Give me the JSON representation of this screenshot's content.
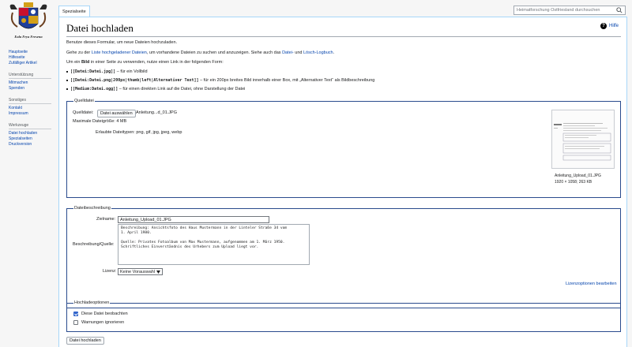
{
  "logo": {
    "motto": "Eala Frya Fresena"
  },
  "sidebar": {
    "nav": [
      {
        "label": "Hauptseite"
      },
      {
        "label": "Hilfeseite"
      },
      {
        "label": "Zufälliger Artikel"
      }
    ],
    "sections": [
      {
        "heading": "Unterstützung",
        "items": [
          {
            "label": "Mitmachen"
          },
          {
            "label": "Spenden"
          }
        ]
      },
      {
        "heading": "Sonstiges",
        "items": [
          {
            "label": "Kontakt"
          },
          {
            "label": "Impressum"
          }
        ]
      },
      {
        "heading": "Werkzeuge",
        "items": [
          {
            "label": "Datei hochladen"
          },
          {
            "label": "Spezialseiten"
          },
          {
            "label": "Druckversion"
          }
        ]
      }
    ]
  },
  "tabs": {
    "special": "Spezialseite"
  },
  "search": {
    "placeholder": "Heimatforschung Ostfriesland durchsuchen"
  },
  "page": {
    "title": "Datei hochladen",
    "help": "Hilfe",
    "intro1": "Benutze dieses Formular, um neue Dateien hochzuladen.",
    "intro2a": "Gehe zu der ",
    "intro2_link1": "Liste hochgeladener Dateien",
    "intro2b": ", um vorhandene Dateien zu suchen und anzuzeigen. Siehe auch das ",
    "intro2_link2": "Datei-",
    "intro2c": " und ",
    "intro2_link3": "Lösch-Logbuch",
    "intro2d": ".",
    "intro3a": "Um ein ",
    "intro3_bold": "Bild",
    "intro3b": " in einer Seite zu verwenden, nutze einen Link in der folgenden Form:",
    "bullets": [
      {
        "code": "[[Datei:Datei.jpg]]",
        "text": " – für ein Vollbild"
      },
      {
        "code": "[[Datei:Datei.png|200px|thumb|left|Alternativer Text]]",
        "text": " – für ein 200px breites Bild innerhalb einer Box, mit „Alternativer Text“ als Bildbeschreibung"
      },
      {
        "code": "[[Medium:Datei.ogg]]",
        "text": " – für einen direkten Link auf die Datei, ohne Darstellung der Datei"
      }
    ]
  },
  "source": {
    "legend": "Quelldatei",
    "file_label": "Quelldatei:",
    "choose_button": "Datei auswählen",
    "chosen_file": "Anleitung...d_01.JPG",
    "max_size": "Maximale Dateigröße: 4 MB",
    "allowed_types": "Erlaubte Dateitypen: png, gif, jpg, jpeg, webp",
    "thumb_name": "Anleitung_Upload_01.JPG",
    "thumb_meta": "1920 × 1058; 263 KB"
  },
  "description": {
    "legend": "Dateibeschreibung",
    "target_label": "Zielname:",
    "target_value": "Anleitung_Upload_01.JPG",
    "desc_label": "Beschreibung/Quelle:",
    "desc_value": "Beschreibung: Ansichtsfoto des Haus Mustermann in der Linteler Straße 34 vom\n1. April 1980.\n\nQuelle: Privates Fotoalbum von Max Mustermann, aufgenommen am 1. März 1950.\nSchriftliches Einverständnis des Urhebers zum Upload liegt vor.",
    "license_label": "Lizenz:",
    "license_value": "Keine Vorauswahl",
    "license_link": "Lizenzoptionen bearbeiten"
  },
  "options": {
    "legend": "Hochladeoptionen",
    "watch_label": "Diese Datei beobachten",
    "watch_checked": true,
    "ignore_label": "Warnungen ignorieren",
    "ignore_checked": false
  },
  "submit": {
    "label": "Datei hochladen"
  },
  "colors": {
    "link": "#0645ad",
    "border": "#a7d7f9",
    "fieldset": "#2a4b8d",
    "checkbox": "#3366cc"
  }
}
